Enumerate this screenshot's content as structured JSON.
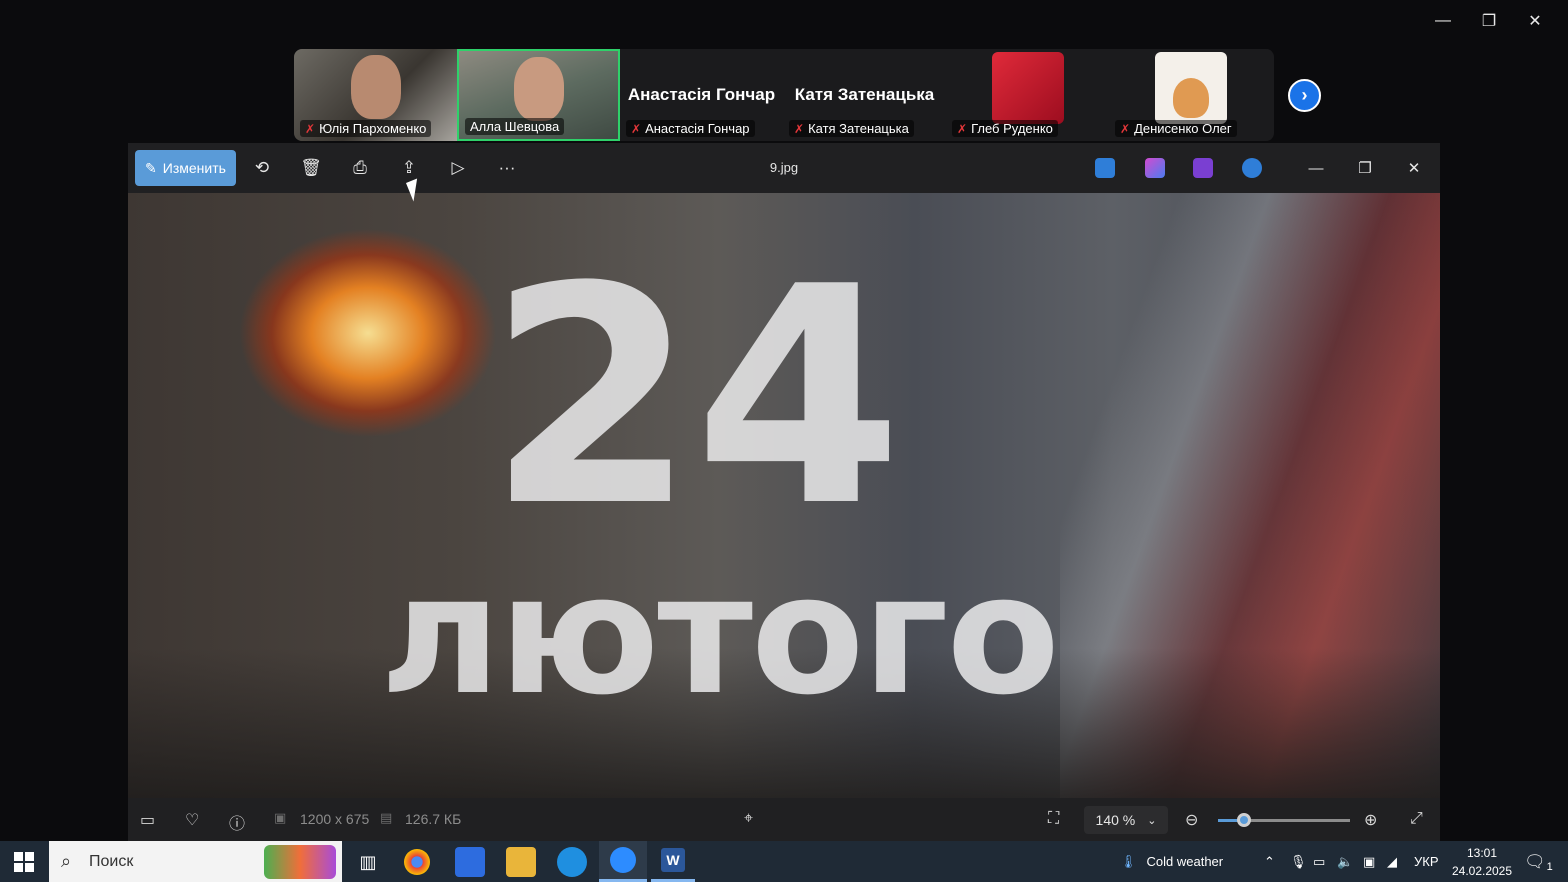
{
  "zoom_window": {
    "controls": {
      "minimize": "—",
      "restore": "❐",
      "close": "✕"
    }
  },
  "participants": [
    {
      "name": "Юлія Пархоменко",
      "muted": true,
      "type": "video"
    },
    {
      "name": "Алла Шевцова",
      "muted": false,
      "type": "video",
      "active_speaker": true
    },
    {
      "name": "Анастасія Гончар",
      "display_name": "Анастасія Гончар",
      "muted": true,
      "type": "name"
    },
    {
      "name": "Катя Затенацька",
      "display_name": "Катя Затенацька",
      "muted": true,
      "type": "name"
    },
    {
      "name": "Глеб Руденко",
      "muted": true,
      "type": "avatar"
    },
    {
      "name": "Денисенко Олег",
      "muted": true,
      "type": "avatar"
    }
  ],
  "photo_viewer": {
    "edit_label": "Изменить",
    "file_title": "9.jpg",
    "more_label": "···",
    "image_text": {
      "number": "24",
      "word": "лютого"
    },
    "status": {
      "dimensions": "1200 x 675",
      "file_size": "126.7 КБ",
      "zoom_percent": "140 %",
      "zoom_level": 0.2
    }
  },
  "taskbar": {
    "search_placeholder": "Поиск",
    "weather": "Cold weather",
    "language": "УКР",
    "time": "13:01",
    "date": "24.02.2025",
    "notification_count": "1"
  },
  "colors": {
    "accent": "#5a9bd8",
    "speaker_border": "#2fd16a",
    "mic_off": "#e5373a",
    "next_button": "#1a73e8",
    "taskbar": "#1f2a36"
  }
}
